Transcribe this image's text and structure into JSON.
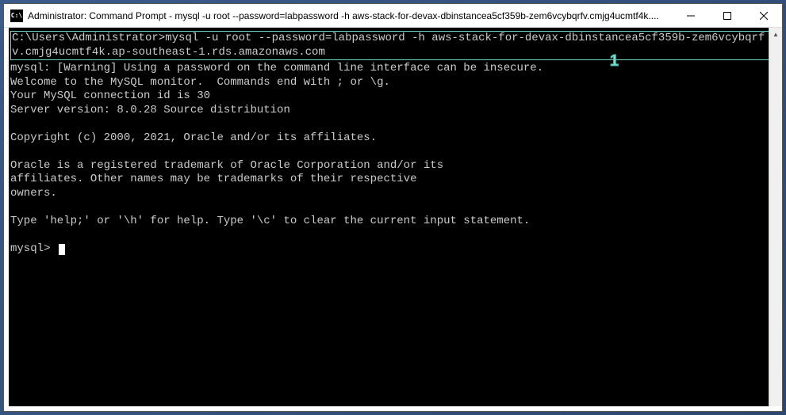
{
  "titlebar": {
    "icon_text": "C:\\",
    "title": "Administrator: Command Prompt - mysql  -u root --password=labpassword -h aws-stack-for-devax-dbinstancea5cf359b-zem6vcybqrfv.cmjg4ucmtf4k...."
  },
  "terminal": {
    "prompt": "C:\\Users\\Administrator>",
    "command": "mysql -u root --password=labpassword -h aws-stack-for-devax-dbinstancea5cf359b-zem6vcybqrfv.cmjg4ucmtf4k.ap-southeast-1.rds.amazonaws.com",
    "line_warning": "mysql: [Warning] Using a password on the command line interface can be insecure.",
    "line_welcome": "Welcome to the MySQL monitor.  Commands end with ; or \\g.",
    "line_conn_id": "Your MySQL connection id is 30",
    "line_server": "Server version: 8.0.28 Source distribution",
    "line_copyright": "Copyright (c) 2000, 2021, Oracle and/or its affiliates.",
    "line_trademark1": "Oracle is a registered trademark of Oracle Corporation and/or its",
    "line_trademark2": "affiliates. Other names may be trademarks of their respective",
    "line_trademark3": "owners.",
    "line_help": "Type 'help;' or '\\h' for help. Type '\\c' to clear the current input statement.",
    "mysql_prompt": "mysql> "
  },
  "annotation": {
    "label": "1"
  }
}
